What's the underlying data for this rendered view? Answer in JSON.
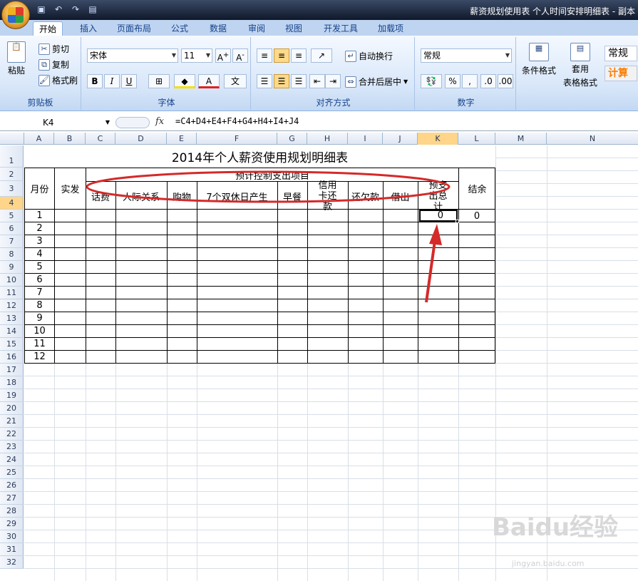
{
  "window": {
    "title": "薪资规划使用表 个人时间安排明细表 - 副本"
  },
  "ribbon_tabs": [
    "开始",
    "插入",
    "页面布局",
    "公式",
    "数据",
    "审阅",
    "视图",
    "开发工具",
    "加载项"
  ],
  "clipboard": {
    "paste": "粘贴",
    "cut": "剪切",
    "copy": "复制",
    "format_painter": "格式刷",
    "label": "剪贴板"
  },
  "font": {
    "name": "宋体",
    "size": "11",
    "bold": "B",
    "italic": "I",
    "underline": "U",
    "label": "字体"
  },
  "alignment": {
    "wrap": "自动换行",
    "merge": "合并后居中",
    "label": "对齐方式"
  },
  "number": {
    "format": "常规",
    "percent": "%",
    "comma": ",",
    "label": "数字"
  },
  "styles": {
    "conditional": "条件格式",
    "table_format_1": "套用",
    "table_format_2": "表格格式",
    "style_normal": "常规",
    "style_calc": "计算"
  },
  "formula_bar": {
    "name_box": "K4",
    "fx": "fx",
    "formula": "=C4+D4+E4+F4+G4+H4+I4+J4"
  },
  "columns": [
    "A",
    "B",
    "C",
    "D",
    "E",
    "F",
    "G",
    "H",
    "I",
    "J",
    "K",
    "L",
    "M",
    "N"
  ],
  "rows": [
    "1",
    "2",
    "3",
    "4",
    "5",
    "6",
    "7",
    "8",
    "9",
    "10",
    "11",
    "12",
    "13",
    "14",
    "15",
    "16",
    "17",
    "18",
    "19",
    "20",
    "21",
    "22",
    "23",
    "24",
    "25",
    "26",
    "27",
    "28",
    "29",
    "30",
    "31",
    "32"
  ],
  "sheet": {
    "title": "2014年个人薪资使用规划明细表",
    "month_header": "月份",
    "actual_header": "实发",
    "planned_header": "预计控制支出项目",
    "expense_items": [
      "话费",
      "人际关系",
      "购物",
      "7个双休日产生",
      "早餐",
      "信用卡还款",
      "还欠款",
      "借出"
    ],
    "total_header": "预支出总计",
    "balance_header": "结余",
    "months": [
      "1",
      "2",
      "3",
      "4",
      "5",
      "6",
      "7",
      "8",
      "9",
      "10",
      "11",
      "12"
    ],
    "k4_value": "0",
    "l4_value": "0"
  },
  "watermark": {
    "brand": "Baidu经验",
    "url": "jingyan.baidu.com"
  },
  "colors": {
    "annotation": "#e02020",
    "selected_header": "#ffd58a"
  }
}
